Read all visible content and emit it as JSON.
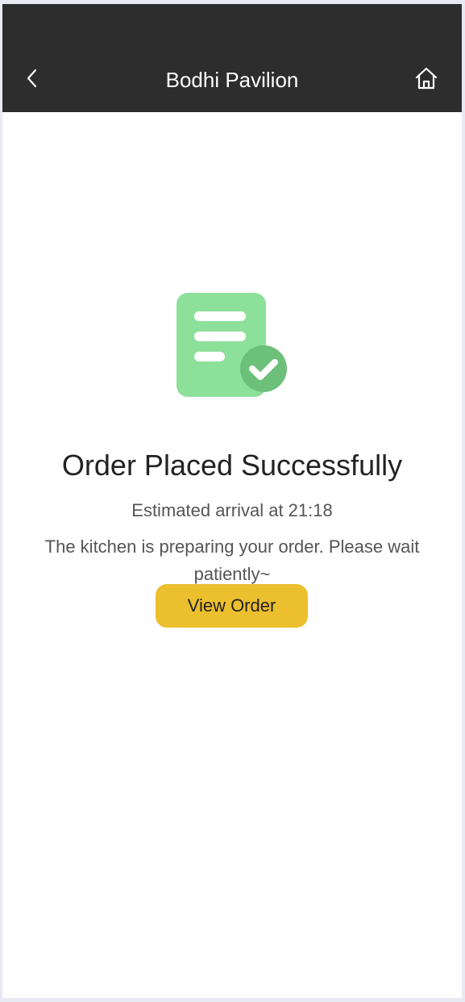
{
  "header": {
    "title": "Bodhi Pavilion",
    "back_icon": "chevron-left-icon",
    "home_icon": "home-icon",
    "background": "#2d2d2d"
  },
  "status": {
    "icon": "order-success-icon",
    "title": "Order Placed Successfully",
    "eta": "Estimated arrival at 21:18",
    "message": "The kitchen is preparing your order. Please wait patiently~"
  },
  "actions": {
    "view_order_label": "View Order",
    "button_color": "#ecbf2e"
  },
  "colors": {
    "icon_doc": "#8de09a",
    "icon_check": "#6cc07a"
  }
}
